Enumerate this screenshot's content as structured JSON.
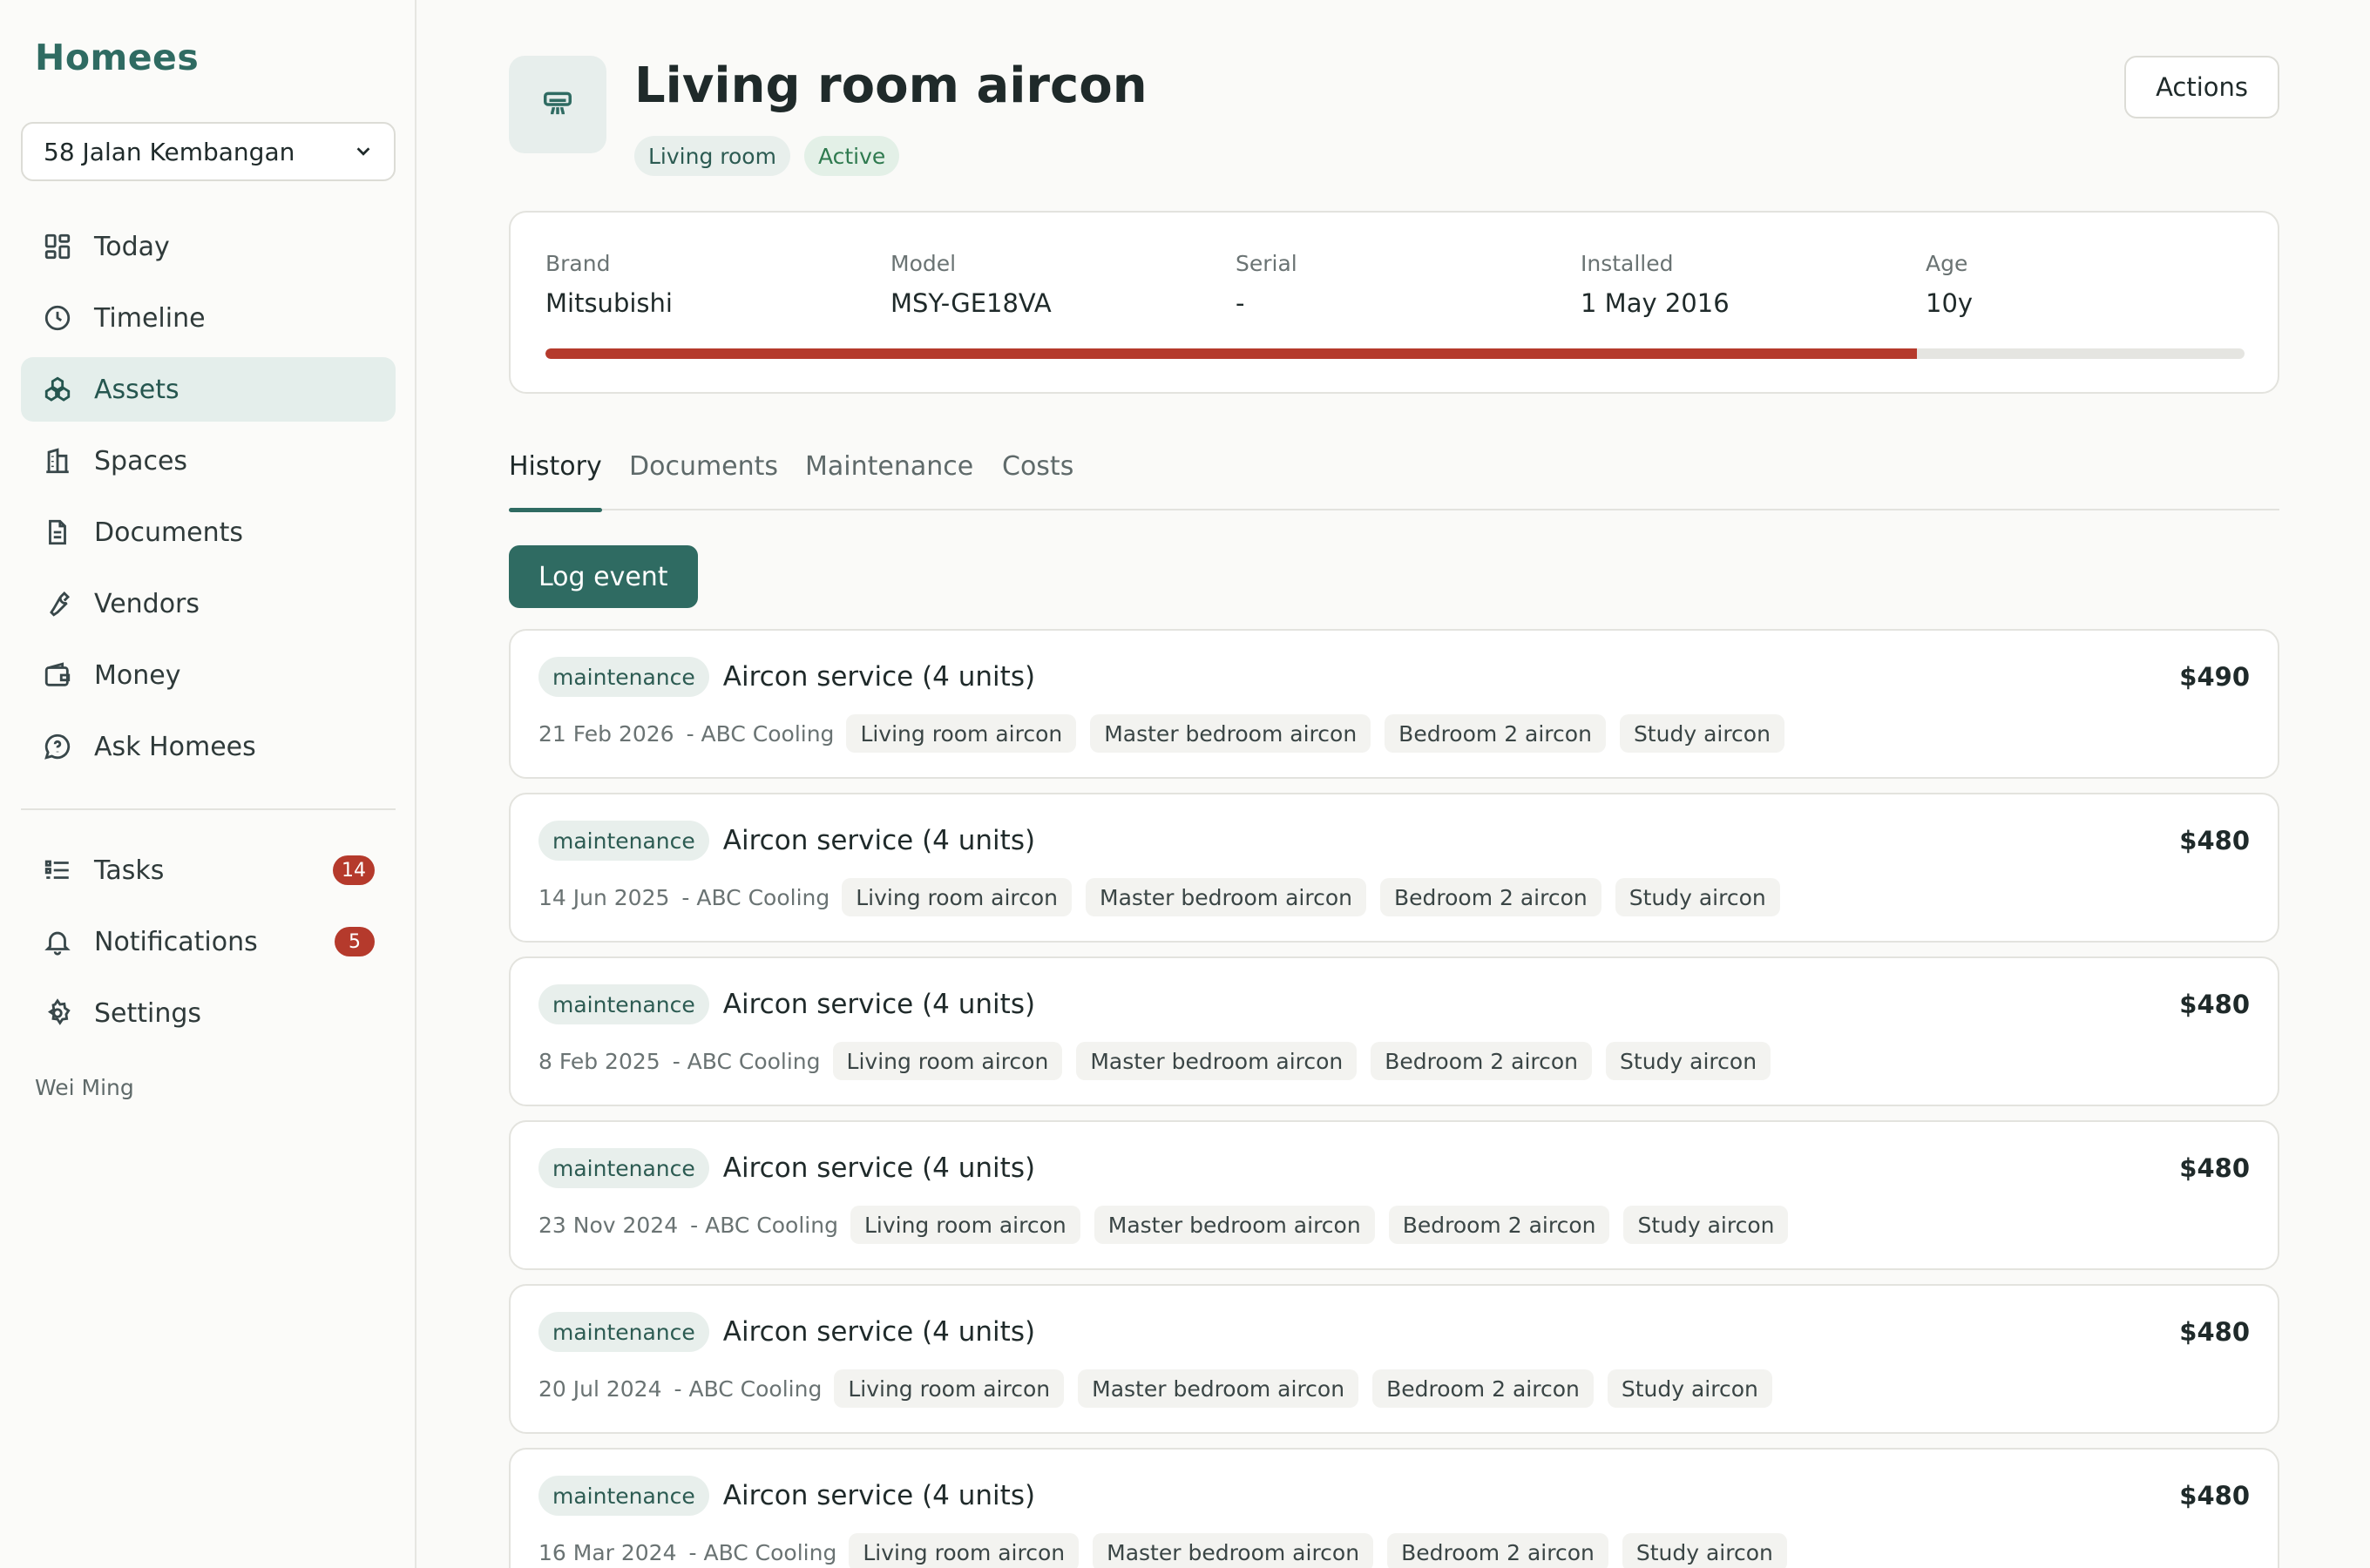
{
  "app": {
    "brand": "Homees"
  },
  "sidebar": {
    "property": "58 Jalan Kembangan",
    "items": [
      {
        "label": "Today",
        "icon": "grid-icon"
      },
      {
        "label": "Timeline",
        "icon": "clock-icon"
      },
      {
        "label": "Assets",
        "icon": "assets-icon",
        "active": true
      },
      {
        "label": "Spaces",
        "icon": "building-icon"
      },
      {
        "label": "Documents",
        "icon": "document-icon"
      },
      {
        "label": "Vendors",
        "icon": "wrench-icon"
      },
      {
        "label": "Money",
        "icon": "wallet-icon"
      },
      {
        "label": "Ask Homees",
        "icon": "chat-icon"
      }
    ],
    "secondary": [
      {
        "label": "Tasks",
        "icon": "tasks-icon",
        "badge": "14"
      },
      {
        "label": "Notifications",
        "icon": "bell-icon",
        "badge": "5"
      },
      {
        "label": "Settings",
        "icon": "gear-icon"
      }
    ],
    "user": "Wei Ming"
  },
  "asset": {
    "title": "Living room aircon",
    "space": "Living room",
    "status": "Active",
    "actions_label": "Actions",
    "specs": {
      "brand_label": "Brand",
      "brand": "Mitsubishi",
      "model_label": "Model",
      "model": "MSY-GE18VA",
      "serial_label": "Serial",
      "serial": "-",
      "installed_label": "Installed",
      "installed": "1 May 2016",
      "age_label": "Age",
      "age": "10y"
    },
    "lifespan_used_fraction": 0.807
  },
  "tabs": [
    "History",
    "Documents",
    "Maintenance",
    "Costs"
  ],
  "log_event_label": "Log event",
  "events": [
    {
      "type": "maintenance",
      "title": "Aircon service (4 units)",
      "cost": "$490",
      "date": "21 Feb 2026",
      "vendor": "- ABC Cooling",
      "assets": [
        "Living room aircon",
        "Master bedroom aircon",
        "Bedroom 2 aircon",
        "Study aircon"
      ]
    },
    {
      "type": "maintenance",
      "title": "Aircon service (4 units)",
      "cost": "$480",
      "date": "14 Jun 2025",
      "vendor": "- ABC Cooling",
      "assets": [
        "Living room aircon",
        "Master bedroom aircon",
        "Bedroom 2 aircon",
        "Study aircon"
      ]
    },
    {
      "type": "maintenance",
      "title": "Aircon service (4 units)",
      "cost": "$480",
      "date": "8 Feb 2025",
      "vendor": "- ABC Cooling",
      "assets": [
        "Living room aircon",
        "Master bedroom aircon",
        "Bedroom 2 aircon",
        "Study aircon"
      ]
    },
    {
      "type": "maintenance",
      "title": "Aircon service (4 units)",
      "cost": "$480",
      "date": "23 Nov 2024",
      "vendor": "- ABC Cooling",
      "assets": [
        "Living room aircon",
        "Master bedroom aircon",
        "Bedroom 2 aircon",
        "Study aircon"
      ]
    },
    {
      "type": "maintenance",
      "title": "Aircon service (4 units)",
      "cost": "$480",
      "date": "20 Jul 2024",
      "vendor": "- ABC Cooling",
      "assets": [
        "Living room aircon",
        "Master bedroom aircon",
        "Bedroom 2 aircon",
        "Study aircon"
      ]
    },
    {
      "type": "maintenance",
      "title": "Aircon service (4 units)",
      "cost": "$480",
      "date": "16 Mar 2024",
      "vendor": "- ABC Cooling",
      "assets": [
        "Living room aircon",
        "Master bedroom aircon",
        "Bedroom 2 aircon",
        "Study aircon"
      ]
    }
  ]
}
